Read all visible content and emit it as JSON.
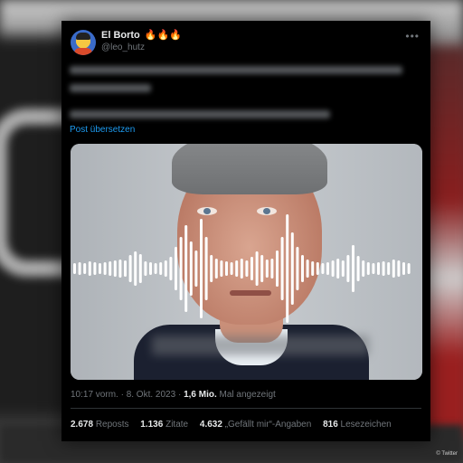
{
  "tweet": {
    "display_name": "El Borto",
    "name_emoji": "🔥🔥🔥",
    "handle": "@leo_hutz",
    "more_icon": "more-icon",
    "translate_label": "Post übersetzen",
    "timestamp": "10:17 vorm. · 8. Okt. 2023 ·",
    "views_count": "1,6 Mio.",
    "views_label": "Mal angezeigt"
  },
  "stats": [
    {
      "count": "2.678",
      "label": "Reposts"
    },
    {
      "count": "1.136",
      "label": "Zitate"
    },
    {
      "count": "4.632",
      "label": "„Gefällt mir“-Angaben"
    },
    {
      "count": "816",
      "label": "Lesezeichen"
    }
  ],
  "credit": "© Twitter",
  "colors": {
    "card": "#000000",
    "link": "#1d9bf0",
    "muted": "#71767b",
    "text": "#e7e9ea"
  }
}
